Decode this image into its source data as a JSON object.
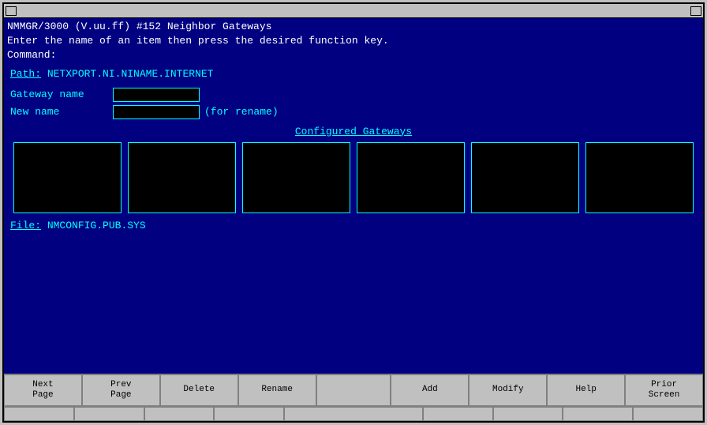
{
  "window": {
    "title": ""
  },
  "header": {
    "line1": "NMMGR/3000 (V.uu.ff) #152  Neighbor Gateways",
    "line2": "Enter the name of an item then press the desired function key.",
    "line3": "Command:"
  },
  "path": {
    "label": "Path:",
    "value": "NETXPORT.NI.NINAME.INTERNET"
  },
  "form": {
    "gateway_name_label": "Gateway name",
    "new_name_label": "New name",
    "for_rename": "(for rename)"
  },
  "gateways": {
    "title": "Configured Gateways",
    "boxes": [
      "",
      "",
      "",
      "",
      "",
      ""
    ]
  },
  "file": {
    "label": "File:",
    "value": "NMCONFIG.PUB.SYS"
  },
  "function_keys": {
    "row1": [
      {
        "label": "Next\nPage",
        "key": "f1"
      },
      {
        "label": "Prev\nPage",
        "key": "f2"
      },
      {
        "label": "Delete",
        "key": "f3"
      },
      {
        "label": "Rename",
        "key": "f4"
      },
      {
        "label": "",
        "key": "f5"
      },
      {
        "label": "Add",
        "key": "f6"
      },
      {
        "label": "Modify",
        "key": "f7"
      },
      {
        "label": "Help",
        "key": "f8"
      },
      {
        "label": "Prior\nScreen",
        "key": "f9"
      }
    ]
  }
}
